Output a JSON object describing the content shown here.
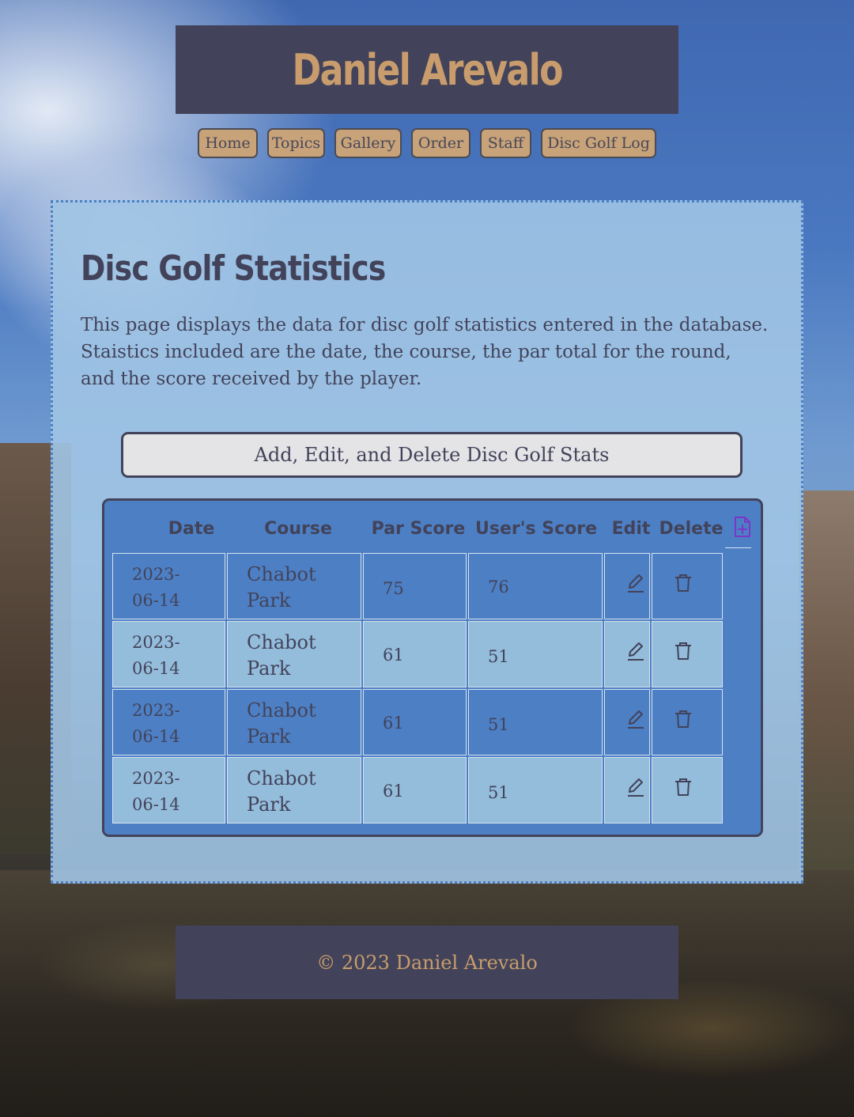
{
  "site": {
    "title": "Daniel Arevalo"
  },
  "nav": [
    {
      "label": "Home"
    },
    {
      "label": "Topics"
    },
    {
      "label": "Gallery"
    },
    {
      "label": "Order"
    },
    {
      "label": "Staff"
    },
    {
      "label": "Disc Golf Log"
    }
  ],
  "page": {
    "title": "Disc Golf Statistics",
    "intro": "This page displays the data for disc golf statistics entered in the database. Staistics included are the date, the course, the par total for the round, and the score received by the player.",
    "manage_button": "Add, Edit, and Delete Disc Golf Stats"
  },
  "table": {
    "headers": {
      "date": "Date",
      "course": "Course",
      "par": "Par Score",
      "user": "User's Score",
      "edit": "Edit",
      "delete": "Delete"
    },
    "rows": [
      {
        "date_line1": "2023-",
        "date_line2": "06-14",
        "course_line1": "Chabot",
        "course_line2": "Park",
        "par": "75",
        "score": "76"
      },
      {
        "date_line1": "2023-",
        "date_line2": "06-14",
        "course_line1": "Chabot",
        "course_line2": "Park",
        "par": "61",
        "score": "51"
      },
      {
        "date_line1": "2023-",
        "date_line2": "06-14",
        "course_line1": "Chabot",
        "course_line2": "Park",
        "par": "61",
        "score": "51"
      },
      {
        "date_line1": "2023-",
        "date_line2": "06-14",
        "course_line1": "Chabot",
        "course_line2": "Park",
        "par": "61",
        "score": "51"
      }
    ]
  },
  "icons": {
    "add": "file-plus-icon",
    "edit": "pencil-icon",
    "delete": "trash-icon"
  },
  "footer": {
    "text": "© 2023 Daniel Arevalo"
  },
  "colors": {
    "banner": "#42435a",
    "title_gold": "#c89c6c",
    "nav_button": "#c8a278",
    "panel": "#a0c4e4",
    "table_blue": "#4d7fc4",
    "row_light": "#94bcdb"
  }
}
